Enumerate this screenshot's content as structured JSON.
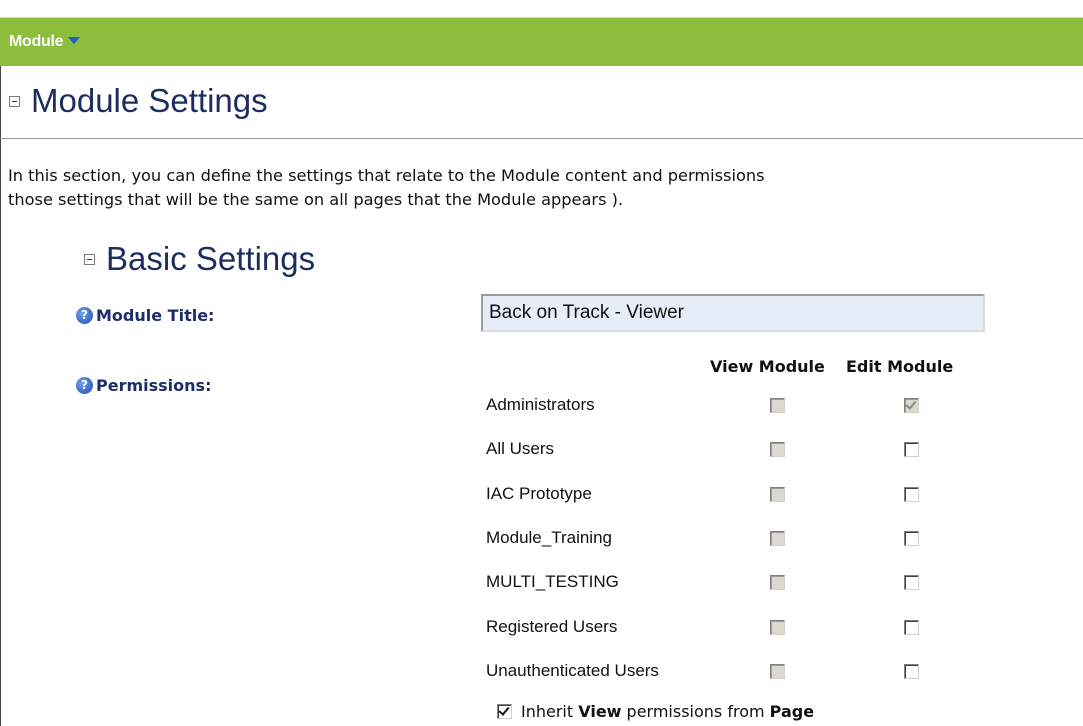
{
  "module_bar": {
    "label": "Module"
  },
  "module_settings": {
    "title": "Module Settings",
    "intro_line1": "In this section, you can define the settings that relate to the Module content and permissions",
    "intro_line2": "those settings that will be the same on all pages that the Module appears )."
  },
  "basic_settings": {
    "title": "Basic Settings",
    "module_title_label": "Module Title:",
    "module_title_value": "Back on Track - Viewer",
    "permissions_label": "Permissions:",
    "columns": [
      "View Module",
      "Edit Module"
    ],
    "roles": [
      {
        "name": "Administrators",
        "view": false,
        "edit": true,
        "edit_disabled": true
      },
      {
        "name": "All Users",
        "view": false,
        "edit": false,
        "edit_disabled": false
      },
      {
        "name": "IAC Prototype",
        "view": false,
        "edit": false,
        "edit_disabled": false
      },
      {
        "name": "Module_Training",
        "view": false,
        "edit": false,
        "edit_disabled": false
      },
      {
        "name": "MULTI_TESTING",
        "view": false,
        "edit": false,
        "edit_disabled": false
      },
      {
        "name": "Registered Users",
        "view": false,
        "edit": false,
        "edit_disabled": false
      },
      {
        "name": "Unauthenticated Users",
        "view": false,
        "edit": false,
        "edit_disabled": false
      }
    ],
    "inherit": {
      "checked": true,
      "prefix": "Inherit",
      "bold1": "View",
      "middle": "permissions from",
      "bold2": "Page"
    }
  },
  "colors": {
    "module_bar": "#8cbd3c",
    "section_title": "#1d2d5e",
    "label": "#1d2d6a",
    "input_bg": "#e6edf8"
  }
}
